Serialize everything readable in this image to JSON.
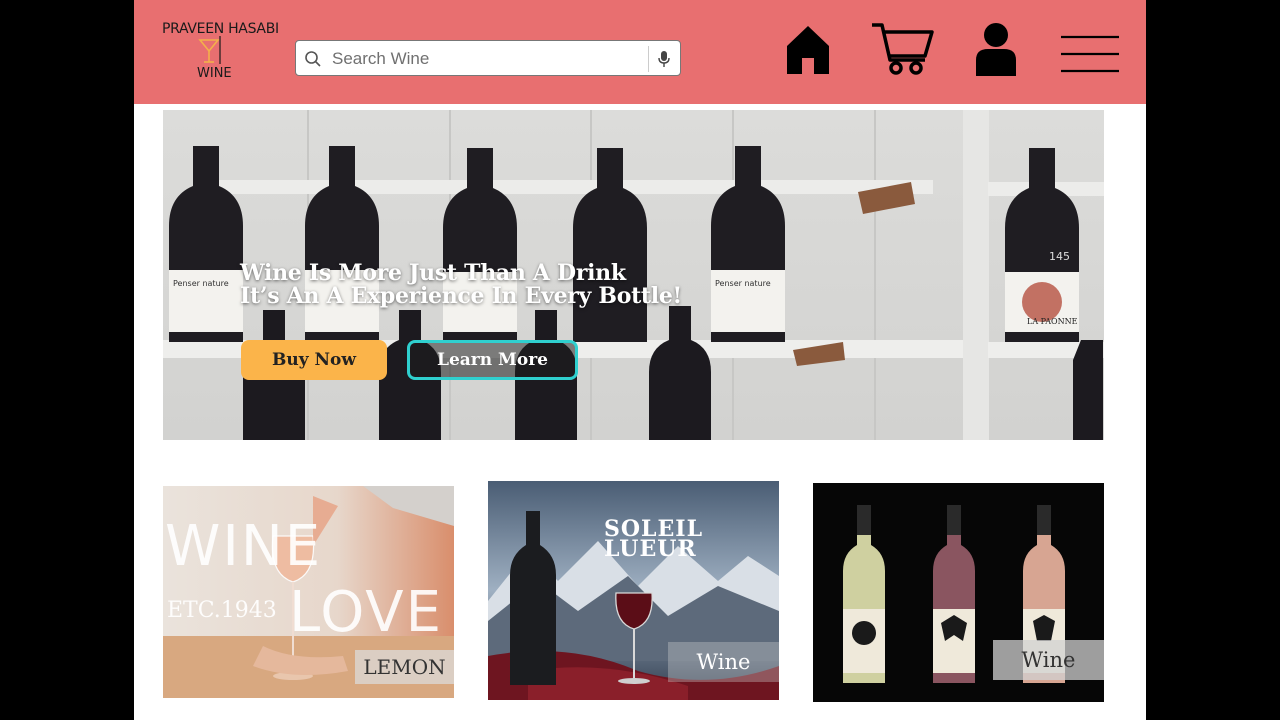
{
  "header": {
    "logo": {
      "line1": "PRAVEEN HASABI",
      "line2": "WINE"
    },
    "search": {
      "placeholder": "Search Wine",
      "value": ""
    },
    "nav": [
      "home",
      "cart",
      "account",
      "menu"
    ],
    "background": "#e86f70"
  },
  "hero": {
    "title_line1": "Wine Is More Just Than A Drink",
    "title_line2": "It’s An A Experience In Every Bottle!",
    "buy_label": "Buy Now",
    "learn_label": "Learn More",
    "bottle_labels": [
      "Penser nature",
      "Penser nature",
      "LA PAONNE",
      "145"
    ],
    "accent_buy": "#fbb44a",
    "accent_learn": "#2fd0cf"
  },
  "cards": [
    {
      "tag": "LEMON",
      "big1": "WINE",
      "big2": "LOVE",
      "est": "ETC.1943"
    },
    {
      "tag": "Wine",
      "brand1": "SOLEIL",
      "brand2": "LUEUR"
    },
    {
      "tag": "Wine"
    }
  ]
}
